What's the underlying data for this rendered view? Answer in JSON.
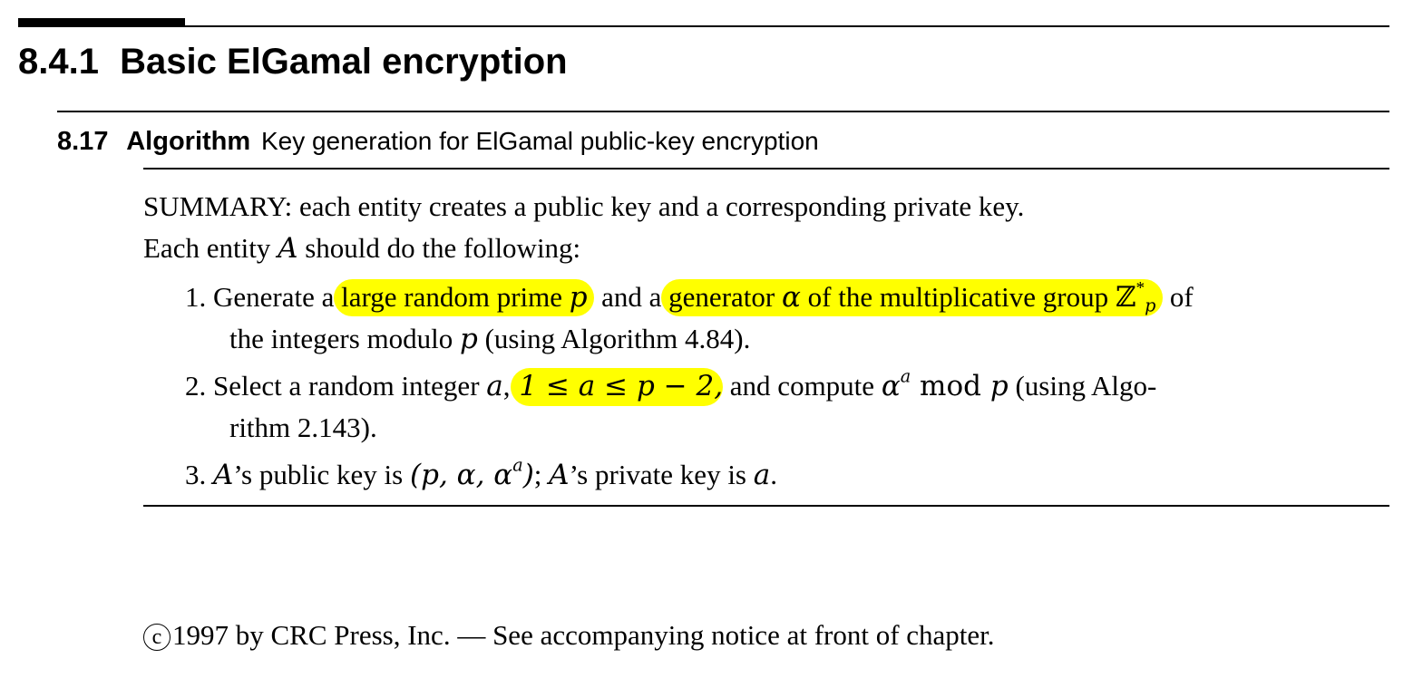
{
  "section": {
    "number": "8.4.1",
    "title": "Basic ElGamal encryption"
  },
  "algorithm": {
    "number": "8.17",
    "keyword": "Algorithm",
    "title": "Key generation for ElGamal public-key encryption"
  },
  "summary": "SUMMARY: each entity creates a public key and a corresponding private key.",
  "intro": {
    "before": "Each entity ",
    "var": "A",
    "after": " should do the following:"
  },
  "steps": [
    {
      "number": "1.",
      "text_a": "Generate a",
      "highlight_a": " large random prime ",
      "highlight_a_var": "p",
      "text_b": " and a",
      "highlight_b": " generator ",
      "highlight_b_var": "α",
      "highlight_b_rest": " of the multiplicative group ",
      "highlight_b_group": "ℤ",
      "highlight_b_group_sup": "*",
      "highlight_b_group_sub": "p",
      "text_c": " of",
      "line2_text": "the integers modulo ",
      "line2_var": "p",
      "line2_rest": " (using Algorithm 4.84)."
    },
    {
      "number": "2.",
      "text_a": "Select a random integer ",
      "var_a": "a",
      "comma": ",",
      "highlight": " 1 ≤ a ≤ p − 2,",
      "text_b": " and compute ",
      "expr_base": "α",
      "expr_exp": "a",
      "mod_word": " mod ",
      "mod_var": "p",
      "text_c": " (using Algo-",
      "line2": "rithm 2.143)."
    },
    {
      "number": "3.",
      "owner": "A",
      "public_label": "’s public key is ",
      "public_key": "(p, α, α",
      "public_key_exp": "a",
      "public_key_close": ")",
      "separator": "; ",
      "owner2": "A",
      "private_label": "’s private key is ",
      "private_key": "a",
      "end": "."
    }
  ],
  "footer": {
    "symbol": "c",
    "text": "1997 by CRC Press, Inc. — See accompanying notice at front of chapter."
  }
}
